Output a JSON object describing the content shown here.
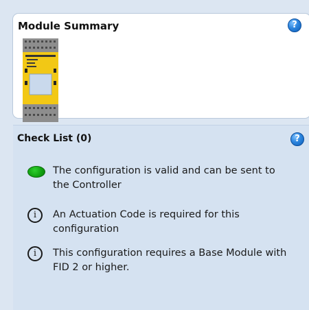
{
  "module_summary": {
    "title": "Module Summary",
    "help_icon": "help-question-icon",
    "help_glyph": "?",
    "module_image": "safety-controller-module-image"
  },
  "check_list": {
    "title": "Check List (0)",
    "help_icon": "help-question-icon",
    "help_glyph": "?",
    "items": [
      {
        "icon": "green-status-icon",
        "text": "The configuration is valid and can be sent to the Controller"
      },
      {
        "icon": "info-icon",
        "glyph": "i",
        "text": "An Actuation Code is required for this configuration"
      },
      {
        "icon": "info-icon",
        "glyph": "i",
        "text": "This configuration requires a Base Module with FID 2 or higher."
      }
    ]
  },
  "colors": {
    "background": "#dce6f2",
    "module_body": "#f2c815",
    "status_ok": "#12a312",
    "help_blue": "#2e86de"
  }
}
